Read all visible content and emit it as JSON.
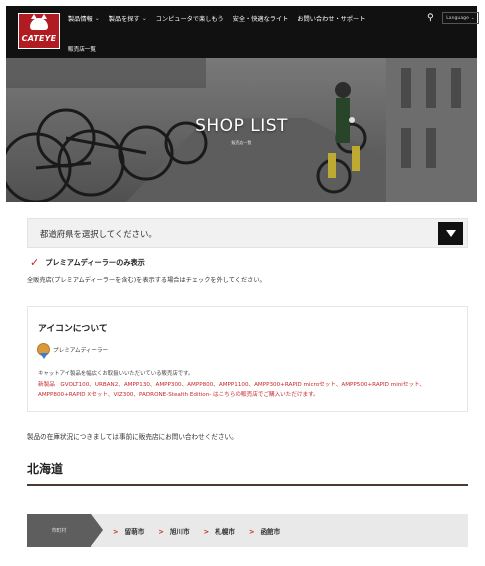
{
  "header": {
    "logo_text": "CATEYE",
    "nav": [
      {
        "label": "製品情報",
        "has_dropdown": true
      },
      {
        "label": "製品を探す",
        "has_dropdown": true
      },
      {
        "label": "コンピュータで楽しもう",
        "has_dropdown": false
      },
      {
        "label": "安全・快適なライト",
        "has_dropdown": false
      },
      {
        "label": "お問い合わせ・サポート",
        "has_dropdown": false
      }
    ],
    "language_label": "Language",
    "subnav_label": "販売店一覧",
    "colors": {
      "bg": "#111111",
      "logo_red": "#b01c22"
    }
  },
  "hero": {
    "title": "SHOP LIST",
    "subtitle": "販売店一覧"
  },
  "main": {
    "prefecture_select": {
      "placeholder": "都道府県を選択してください。"
    },
    "premium_filter": {
      "checked": true,
      "label": "プレミアムディーラーのみ表示",
      "note": "全販売店(プレミアムディーラーを含む)を表示する場合はチェックを外してください。"
    },
    "icon_info": {
      "title": "アイコンについて",
      "premium_label": "プレミアムディーラー",
      "description": "キャットアイ製品を幅広くお取扱いいただいている販売店です。",
      "products_note": "新製品　GVOLT100、URBAN2、AMPP130、AMPP300、AMPP800、AMPP1100、AMPP300+RAPID microセット、AMPP500+RAPID miniセット、AMPP800+RAPID Xセット、VIZ300、PADRONE-Stealth Edition- はこちらの販売店でご購入いただけます。"
    },
    "stock_note": "製品の在庫状況につきましては事前に販売店にお問い合わせください。",
    "region": {
      "name": "北海道",
      "city_header": "市町村",
      "cities": [
        "留萌市",
        "旭川市",
        "札幌市",
        "函館市"
      ]
    },
    "colors": {
      "accent_red": "#c62828",
      "select_button": "#111111",
      "region_line": "#4a3b32"
    }
  }
}
